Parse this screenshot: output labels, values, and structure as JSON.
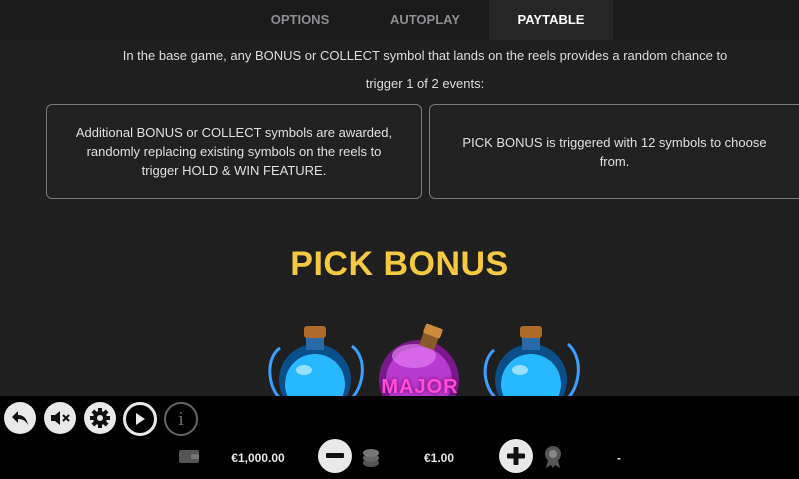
{
  "tabs": [
    {
      "label": "OPTIONS",
      "active": false
    },
    {
      "label": "AUTOPLAY",
      "active": false
    },
    {
      "label": "PAYTABLE",
      "active": true
    }
  ],
  "paytable": {
    "intro_line1": "In the base game, any BONUS or COLLECT symbol that lands on the reels provides a random chance to",
    "intro_line2": "trigger 1 of 2 events:",
    "event_left": "Additional BONUS or COLLECT symbols are awarded, randomly replacing existing symbols on the reels to trigger HOLD & WIN FEATURE.",
    "event_right": "PICK BONUS is triggered with 12 symbols to choose from.",
    "section_title": "PICK BONUS",
    "symbol_label": "MAJOR"
  },
  "bottom_bar": {
    "balance": "€1,000.00",
    "bet": "€1.00",
    "win": "-",
    "icons": [
      "back-icon",
      "mute-icon",
      "settings-icon",
      "spin-icon",
      "info-icon",
      "wallet-icon",
      "minus-icon",
      "coins-icon",
      "plus-icon",
      "award-icon"
    ]
  },
  "colors": {
    "title_gold": "#f5c842",
    "major_pink": "#ff4fd8",
    "background": "#1f1f1f",
    "bar": "#000000"
  }
}
